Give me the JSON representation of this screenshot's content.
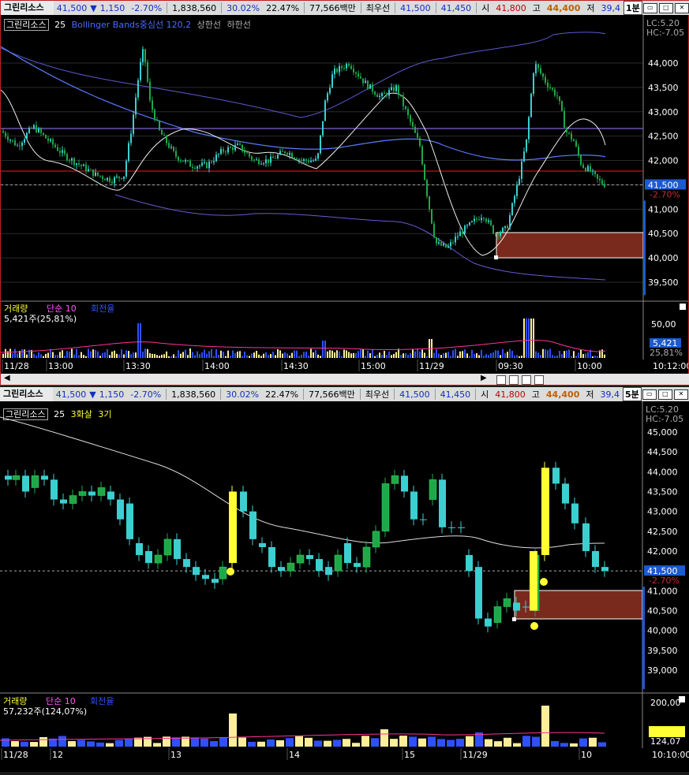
{
  "quote": {
    "name": "그린리소스",
    "price": "41,500",
    "arrow": "▼",
    "change": "1,150",
    "change_pct": "-2.70%",
    "volume": "1,838,560",
    "ratio1": "30.02%",
    "ratio2": "22.47%",
    "amount": "77,566백만",
    "best_label": "최우선",
    "ask": "41,500",
    "bid": "41,450",
    "open_label": "시",
    "open": "41,800",
    "high_label": "고",
    "high": "44,400",
    "low_label": "저",
    "low": "39,4"
  },
  "pane1": {
    "timeframe": "1분",
    "name_tag": "그린리소스",
    "period": "25",
    "indicator": "Bollinger Bands중심선 120,2",
    "upper": "상한선",
    "lower": "하한선",
    "hc_lc": [
      "LC:5.20",
      "HC:-7.05"
    ],
    "price_ticks": [
      "44,000",
      "43,500",
      "43,000",
      "42,500",
      "42,000",
      "41,500",
      "41,000",
      "40,500",
      "40,000",
      "39,500"
    ],
    "last_price": "41,500",
    "last_pct": "-2.70%",
    "vol_title": "거래량",
    "vol_ma": "단순 10",
    "vol_ratio": "회전율",
    "vol_value": "5,421주(25,81%)",
    "vol_ticks": [
      "50,00",
      "25,81%"
    ],
    "vol_last": "5,421",
    "time_labels": [
      "11/28",
      "13:00",
      "13:30",
      "14:00",
      "14:30",
      "15:00",
      "11/29",
      "09:30",
      "10:00"
    ],
    "clock": "10:12:00"
  },
  "pane2": {
    "timeframe": "5분",
    "name_tag": "그린리소스",
    "period": "25",
    "ind1": "3화살",
    "ind2": "3기",
    "hc_lc": [
      "LC:5.20",
      "HC:-7.05"
    ],
    "price_ticks": [
      "45,000",
      "44,500",
      "44,000",
      "43,500",
      "43,000",
      "42,500",
      "42,000",
      "41,500",
      "41,000",
      "40,500",
      "40,000",
      "39,500",
      "39,000"
    ],
    "last_price": "41,500",
    "last_pct": "-2.70%",
    "vol_title": "거래량",
    "vol_ma": "단순 10",
    "vol_ratio": "회전율",
    "vol_value": "57,232주(124,07%)",
    "vol_ticks": [
      "200,00",
      "124,07"
    ],
    "time_labels": [
      "11/28",
      "12",
      "13",
      "14",
      "15",
      "11/29",
      "10"
    ],
    "clock": "10:10:00"
  },
  "colors": {
    "up": "#3ccfd0",
    "down_green": "#1fa84a",
    "accent_yellow": "#ffff33",
    "box_fill": "#7a2a1c",
    "purple_line": "#a07cff",
    "red_line": "#e02020",
    "blue_band": "#5a7cff"
  },
  "icons": [
    "arrow-down-icon",
    "restore-icon",
    "maximize-icon",
    "close-icon"
  ]
}
